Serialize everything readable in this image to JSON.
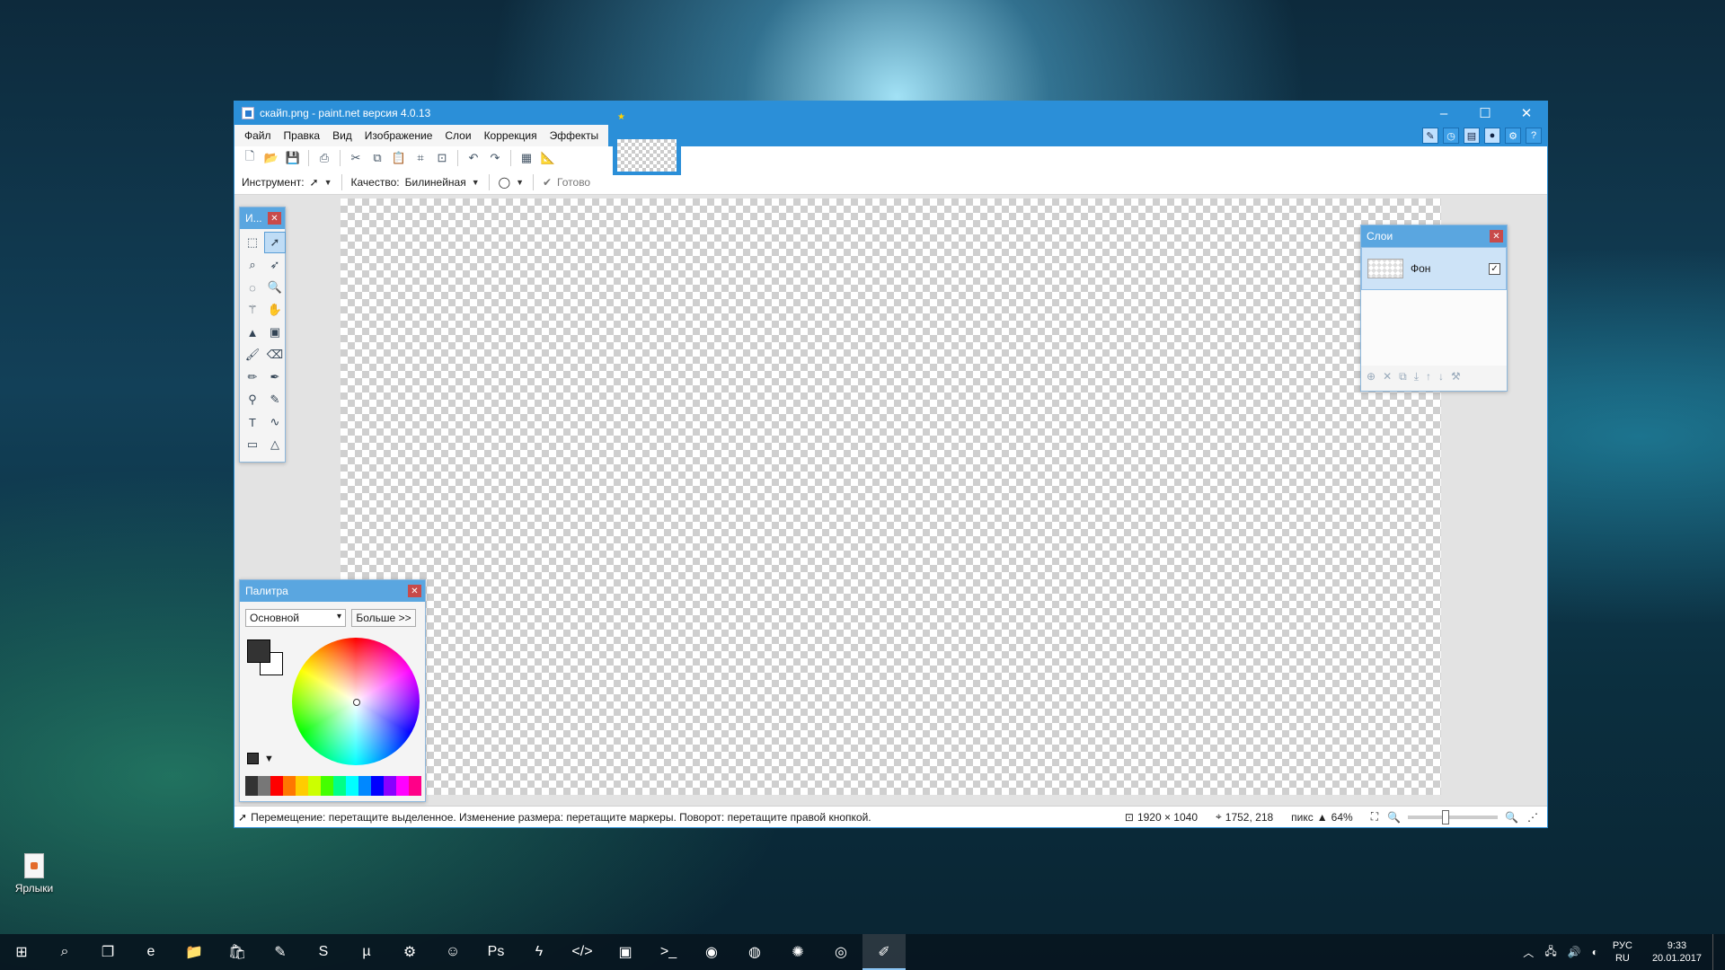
{
  "desktop": {
    "icon_label": "Ярлыки"
  },
  "window": {
    "title": "скайп.png - paint.net версия 4.0.13",
    "controls": {
      "minimize": "–",
      "maximize": "☐",
      "close": "✕"
    }
  },
  "menu": [
    "Файл",
    "Правка",
    "Вид",
    "Изображение",
    "Слои",
    "Коррекция",
    "Эффекты"
  ],
  "toolbar2": {
    "tool_label": "Инструмент:",
    "quality_label": "Качество:",
    "quality_value": "Билинейная",
    "finish_label": "Готово"
  },
  "tools_panel": {
    "title": "И..."
  },
  "layers_panel": {
    "title": "Слои",
    "layers": [
      {
        "name": "Фон",
        "visible": true
      }
    ]
  },
  "palette_panel": {
    "title": "Палитра",
    "palette_select": "Основной",
    "more_button": "Больше >>",
    "primary_color": "#333333",
    "secondary_color": "#ffffff"
  },
  "statusbar": {
    "hint": "Перемещение: перетащите выделенное. Изменение размера: перетащите маркеры. Поворот: перетащите правой кнопкой.",
    "image_size": "1920 × 1040",
    "cursor_pos": "1752, 218",
    "units": "пикс",
    "zoom": "64%"
  },
  "taskbar": {
    "lang_top": "РУС",
    "lang_bottom": "RU",
    "time": "9:33",
    "date": "20.01.2017"
  },
  "colors": {
    "titlebar": "#2b8fd8",
    "accent": "#5aa6e0"
  }
}
